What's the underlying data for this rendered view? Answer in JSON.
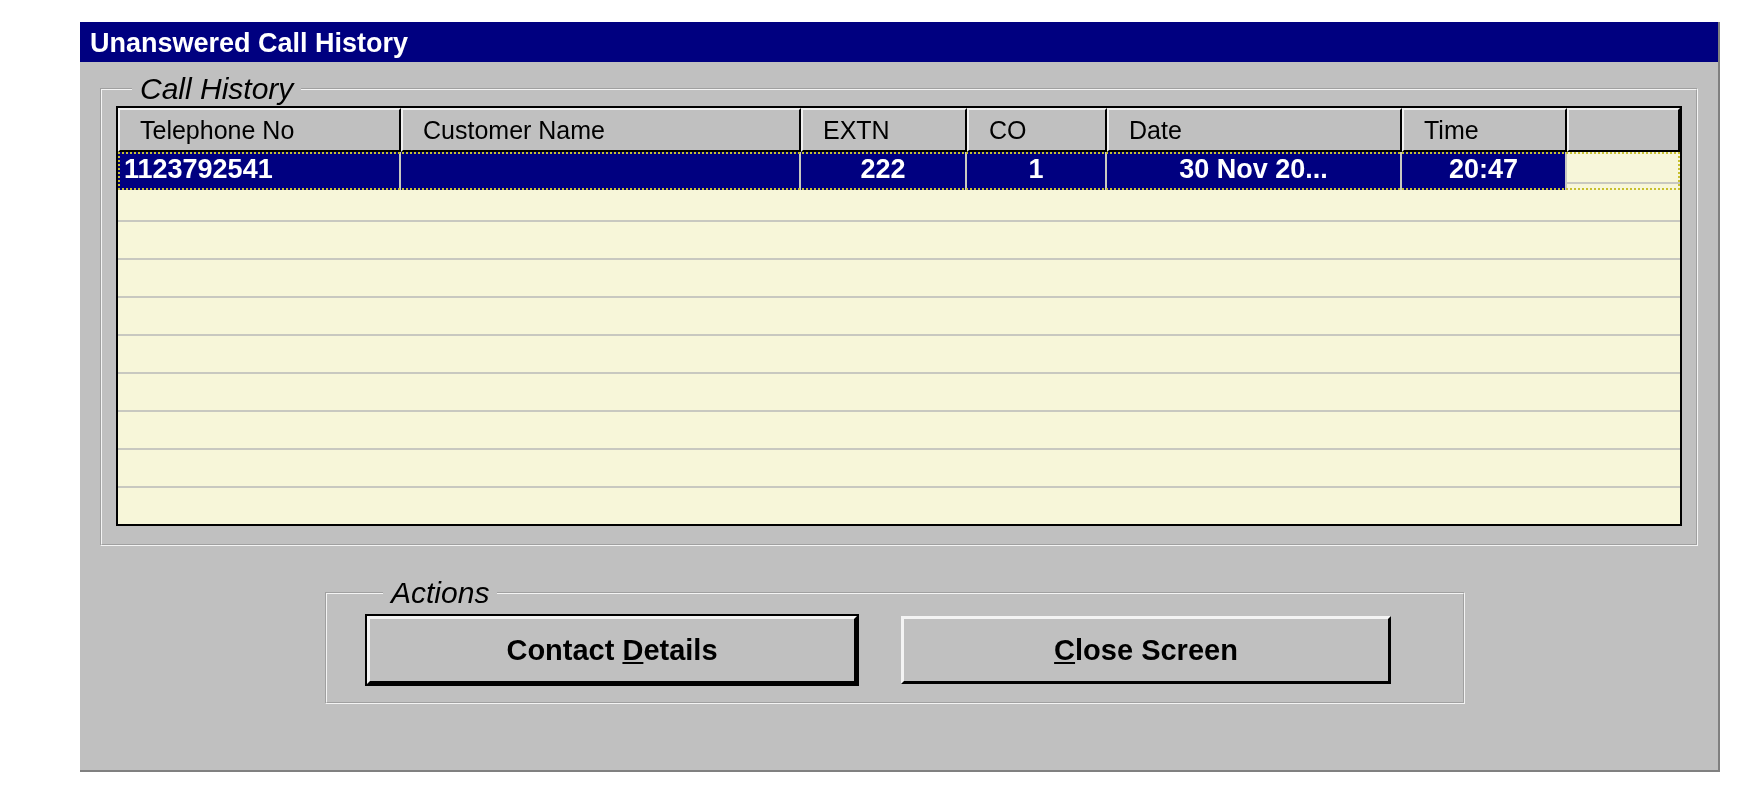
{
  "window": {
    "title": "Unanswered Call History"
  },
  "call_history": {
    "legend": "Call History",
    "table": {
      "columns": [
        "Telephone No",
        "Customer Name",
        "EXTN",
        "CO",
        "Date",
        "Time"
      ],
      "rows": [
        {
          "selected": true,
          "cells": [
            "1123792541",
            "",
            "222",
            "1",
            "30 Nov 20...",
            "20:47"
          ]
        }
      ]
    }
  },
  "actions": {
    "legend": "Actions",
    "buttons": [
      {
        "label_before": "Contact ",
        "mnemonic": "D",
        "label_after": "etails",
        "default": true
      },
      {
        "mnemonic": "C",
        "label_after": "lose Screen",
        "default": false
      }
    ]
  }
}
